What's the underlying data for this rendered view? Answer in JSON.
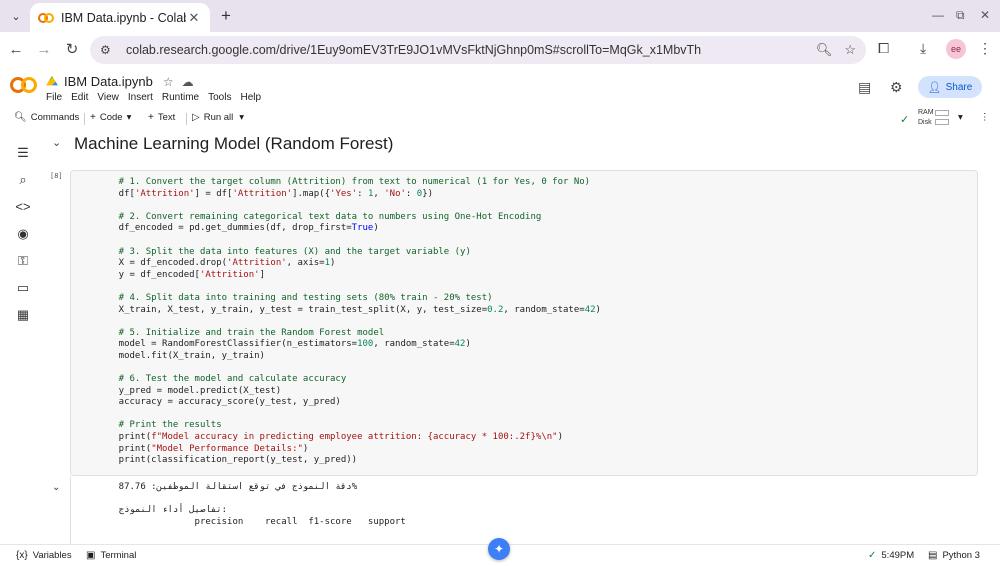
{
  "browser": {
    "tab_title": "IBM Data.ipynb - Colab",
    "tab_close": "✕",
    "new_tab": "+",
    "url": "colab.research.google.com/drive/1Euy9omEV3TrE9JO1vMVsFktNjGhnp0mS#scrollTo=MqGk_x1MbvTh",
    "icons": [
      "tab-menu-icon",
      "back-icon",
      "forward-icon",
      "reload-icon",
      "site-info-icon",
      "zoom-icon",
      "bookmark-star-icon",
      "extensions-icon",
      "download-icon",
      "profile-avatar",
      "more-icon"
    ]
  },
  "colab": {
    "notebook_title": "IBM Data.ipynb",
    "menu": [
      "File",
      "Edit",
      "View",
      "Insert",
      "Runtime",
      "Tools",
      "Help"
    ],
    "share_label": "Share",
    "toolbar": {
      "commands": "Commands",
      "code": "Code",
      "text": "Text",
      "run_all": "Run all",
      "ram": "RAM",
      "disk": "Disk"
    }
  },
  "notebook": {
    "section_title": "Machine Learning Model (Random Forest)",
    "cell_exec_count": "[8]",
    "code_lines": [
      "    # 1. Convert the target column (Attrition) from text to numerical (1 for Yes, 0 for No)",
      "    df['Attrition'] = df['Attrition'].map({'Yes': 1, 'No': 0})",
      "",
      "    # 2. Convert remaining categorical text data to numbers using One-Hot Encoding",
      "    df_encoded = pd.get_dummies(df, drop_first=True)",
      "",
      "    # 3. Split the data into features (X) and the target variable (y)",
      "    X = df_encoded.drop('Attrition', axis=1)",
      "    y = df_encoded['Attrition']",
      "",
      "    # 4. Split data into training and testing sets (80% train - 20% test)",
      "    X_train, X_test, y_train, y_test = train_test_split(X, y, test_size=0.2, random_state=42)",
      "",
      "    # 5. Initialize and train the Random Forest model",
      "    model = RandomForestClassifier(n_estimators=100, random_state=42)",
      "    model.fit(X_train, y_train)",
      "",
      "    # 6. Test the model and calculate accuracy",
      "    y_pred = model.predict(X_test)",
      "    accuracy = accuracy_score(y_test, y_pred)",
      "",
      "    # Print the results",
      "    print(f\"Model accuracy in predicting employee attrition: {accuracy * 100:.2f}%\\n\")",
      "    print(\"Model Performance Details:\")",
      "    print(classification_report(y_test, y_pred))"
    ],
    "output_lines": [
      "    87.76 :دقة النموذج في توقع استقالة الموظفين%",
      "",
      "    تفاصيل أداء النموذج:",
      "                  precision    recall  f1-score   support"
    ]
  },
  "statusbar": {
    "variables": "Variables",
    "terminal": "Terminal",
    "time": "5:49PM",
    "runtime": "Python 3"
  }
}
